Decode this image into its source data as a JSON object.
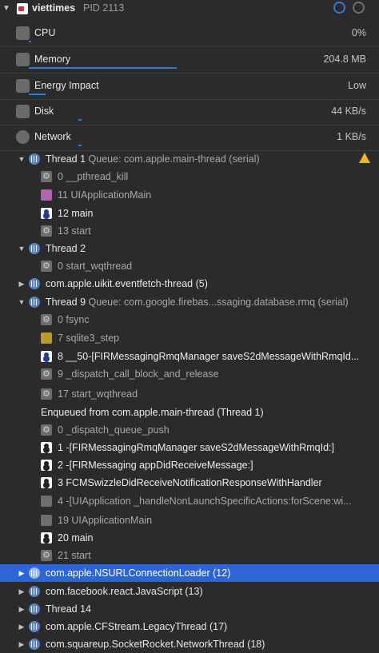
{
  "header": {
    "app_name": "viettimes",
    "pid": "PID 2113"
  },
  "gauges": [
    {
      "label": "CPU",
      "value": "0%",
      "level_fraction": 0.0
    },
    {
      "label": "Memory",
      "value": "204.8 MB",
      "level_fraction": 0.45
    },
    {
      "label": "Energy Impact",
      "value": "Low",
      "level_fraction": 0.05
    },
    {
      "label": "Disk",
      "value": "44 KB/s",
      "level_fraction": 0.01
    },
    {
      "label": "Network",
      "value": "1 KB/s",
      "level_fraction": 0.01
    }
  ],
  "threads": {
    "t1": {
      "title": "Thread 1",
      "queue": "Queue: com.apple.main-thread (serial)",
      "frames": [
        "0 __pthread_kill",
        "11 UIApplicationMain",
        "12 main",
        "13 start"
      ]
    },
    "t2": {
      "title": "Thread 2",
      "frames": [
        "0 start_wqthread"
      ]
    },
    "uikit_event": {
      "title": "com.apple.uikit.eventfetch-thread (5)"
    },
    "t9": {
      "title": "Thread 9",
      "queue": "Queue: com.google.firebas...ssaging.database.rmq (serial)",
      "frames": [
        "0 fsync",
        "7 sqlite3_step",
        "8 __50-[FIRMessagingRmqManager saveS2dMessageWithRmqId...",
        "9 _dispatch_call_block_and_release",
        "17 start_wqthread"
      ],
      "enqueued_label": "Enqueued from com.apple.main-thread (Thread 1)",
      "enqueued_frames": [
        "0 _dispatch_queue_push",
        "1 -[FIRMessagingRmqManager saveS2dMessageWithRmqId:]",
        "2 -[FIRMessaging appDidReceiveMessage:]",
        "3 FCMSwizzleDidReceiveNotificationResponseWithHandler",
        "4 -[UIApplication _handleNonLaunchSpecificActions:forScene:wi...",
        "19 UIApplicationMain",
        "20 main",
        "21 start"
      ]
    },
    "nsurl": {
      "title": "com.apple.NSURLConnectionLoader (12)"
    },
    "react_js": {
      "title": "com.facebook.react.JavaScript (13)"
    },
    "t14": {
      "title": "Thread 14"
    },
    "cfstream": {
      "title": "com.apple.CFStream.LegacyThread (17)"
    },
    "socketrocket": {
      "title": "com.squareup.SocketRocket.NetworkThread (18)"
    }
  }
}
